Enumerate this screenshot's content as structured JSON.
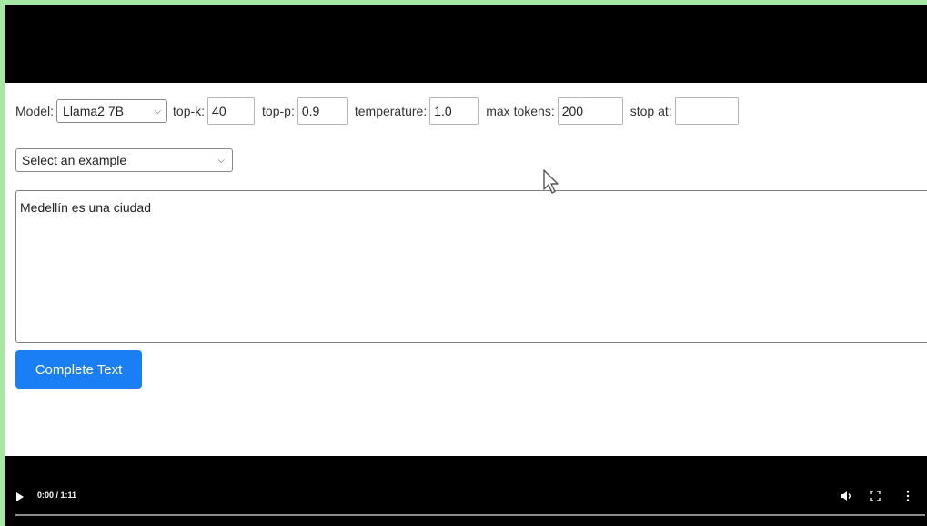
{
  "params": {
    "model_label": "Model:",
    "model_value": "Llama2 7B",
    "topk_label": "top-k:",
    "topk_value": "40",
    "topp_label": "top-p:",
    "topp_value": "0.9",
    "temperature_label": "temperature:",
    "temperature_value": "1.0",
    "max_tokens_label": "max tokens:",
    "max_tokens_value": "200",
    "stop_label": "stop at:",
    "stop_value": ""
  },
  "example_select": {
    "value": "Select an example"
  },
  "prompt": {
    "value": "Medellín es una ciudad"
  },
  "complete_button": {
    "label": "Complete Text"
  },
  "video": {
    "time": "0:00 / 1:11",
    "progress": 0
  },
  "icons": {
    "play": "play-icon",
    "volume": "volume-icon",
    "fullscreen": "fullscreen-icon",
    "more": "more-vertical-icon",
    "cursor": "mouse-cursor-icon"
  },
  "colors": {
    "accent": "#1a7ef5",
    "video_bg": "#000000",
    "border_green": "#a6e8a3"
  }
}
